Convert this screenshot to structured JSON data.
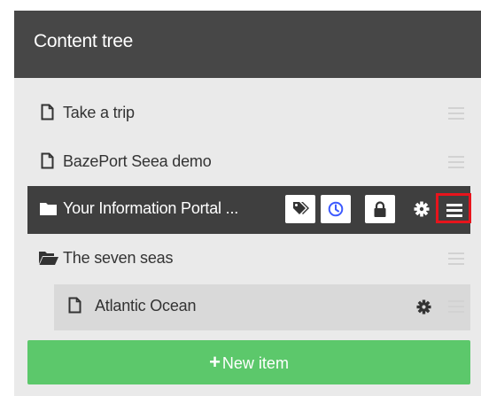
{
  "header": {
    "title": "Content tree"
  },
  "tree": {
    "items": [
      {
        "label": "Take a trip",
        "icon": "file-icon"
      },
      {
        "label": "BazePort Seea demo",
        "icon": "file-icon"
      },
      {
        "label": "Your Information Portal ...",
        "icon": "folder-icon",
        "selected": true,
        "actions": [
          "tags-icon",
          "clock-icon",
          "lock-icon",
          "gear-icon",
          "menu-icon"
        ]
      },
      {
        "label": "The seven seas",
        "icon": "folder-open-icon"
      },
      {
        "label": "Atlantic Ocean",
        "icon": "file-icon",
        "actions": [
          "gear-icon"
        ]
      }
    ]
  },
  "new_item": {
    "label": "New item",
    "icon": "plus-icon"
  },
  "colors": {
    "header_bg": "#474747",
    "panel_bg": "#eaeaea",
    "selected_bg": "#3f3f3f",
    "child_bg": "#d9d9d9",
    "new_item_bg": "#5cc86b",
    "highlight_border": "#e8141c",
    "clock_accent": "#3d5afe"
  }
}
